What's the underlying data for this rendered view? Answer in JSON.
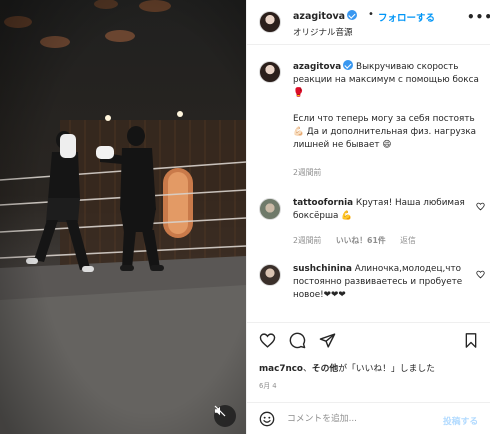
{
  "header": {
    "username": "azagitova",
    "separator": "•",
    "follow_label": "フォローする",
    "audio_label": "オリジナル音源",
    "more_label": "•••"
  },
  "caption": {
    "username": "azagitova",
    "para1": "Выкручиваю скорость реакции на максимум с помощью бокса 🥊",
    "para2": "Если что теперь могу за себя постоять 💪🏻 Да и дополнительная физ. нагрузка лишней не бывает 😄",
    "time": "2週間前"
  },
  "comments": [
    {
      "username": "tattoofornia",
      "text": "Крутая! Наша любимая боксёрша 💪",
      "time": "2週間前",
      "likes": "いいね！61件",
      "reply": "返信"
    },
    {
      "username": "sushchinina",
      "text": "Алиночка,молодец,что постоянно развиваетесь и пробуете новое!❤❤❤"
    }
  ],
  "likes_line": {
    "user": "mac7nco",
    "sep": "、",
    "others": "その他",
    "suffix": "が「いいね！」しました"
  },
  "date": "6月 4",
  "add_comment": {
    "placeholder": "コメントを追加...",
    "post_label": "投稿する"
  },
  "icons": {
    "like": "heart-icon",
    "comment": "comment-icon",
    "share": "share-icon",
    "save": "bookmark-icon",
    "emoji": "emoji-icon",
    "mute": "speaker-muted-icon"
  },
  "colors": {
    "accent": "#0095f6",
    "verified": "#3897f0",
    "post_disabled": "#b3dbff",
    "muted_text": "#8e8e8e"
  }
}
